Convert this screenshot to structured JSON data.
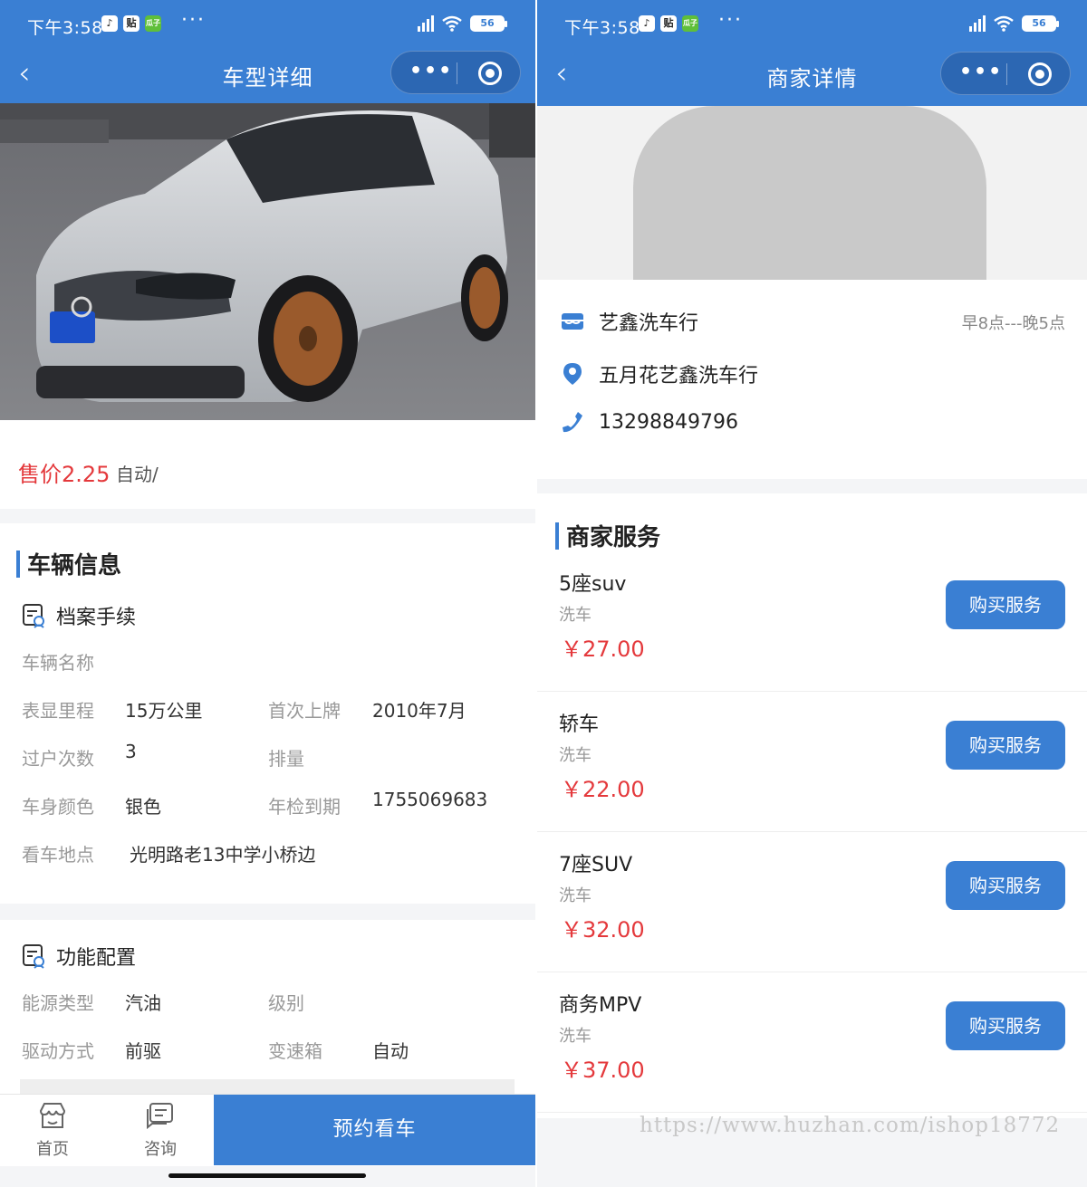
{
  "status_bar": {
    "time": "下午3:58",
    "app1": "♪",
    "app2": "贴",
    "app3": "瓜子",
    "more": "···",
    "battery": "56"
  },
  "left": {
    "nav_title": "车型详细",
    "price_label": "售价2.25",
    "gearbox_text": "自动/",
    "vehicle_info_title": "车辆信息",
    "archive_title": "档案手续",
    "vehicle_name_label": "车辆名称",
    "fields": {
      "mileage_label": "表显里程",
      "mileage_value": "15万公里",
      "first_reg_label": "首次上牌",
      "first_reg_value": "2010年7月",
      "transfers_label": "过户次数",
      "transfers_value": "3",
      "displacement_label": "排量",
      "color_label": "车身颜色",
      "color_value": "银色",
      "inspection_label": "年检到期",
      "inspection_value": "1755069683",
      "location_label": "看车地点",
      "location_value": "光明路老13中学小桥边"
    },
    "function_title": "功能配置",
    "function_fields": {
      "energy_label": "能源类型",
      "energy_value": "汽油",
      "level_label": "级别",
      "drive_label": "驱动方式",
      "drive_value": "前驱",
      "transmission_label": "变速箱",
      "transmission_value": "自动"
    },
    "tabbar": {
      "home": "首页",
      "consult": "咨询",
      "book": "预约看车"
    }
  },
  "right": {
    "nav_title": "商家详情",
    "shop_name": "艺鑫洗车行",
    "hours": "早8点---晚5点",
    "address": "五月花艺鑫洗车行",
    "phone": "13298849796",
    "services_title": "商家服务",
    "services": [
      {
        "name": "5座suv",
        "category": "洗车",
        "price": "￥27.00",
        "button": "购买服务"
      },
      {
        "name": "轿车",
        "category": "洗车",
        "price": "￥22.00",
        "button": "购买服务"
      },
      {
        "name": "7座SUV",
        "category": "洗车",
        "price": "￥32.00",
        "button": "购买服务"
      },
      {
        "name": "商务MPV",
        "category": "洗车",
        "price": "￥37.00",
        "button": "购买服务"
      }
    ]
  },
  "watermark": "https://www.huzhan.com/ishop18772",
  "colors": {
    "primary": "#3a7fd3",
    "price": "#e4393c"
  }
}
